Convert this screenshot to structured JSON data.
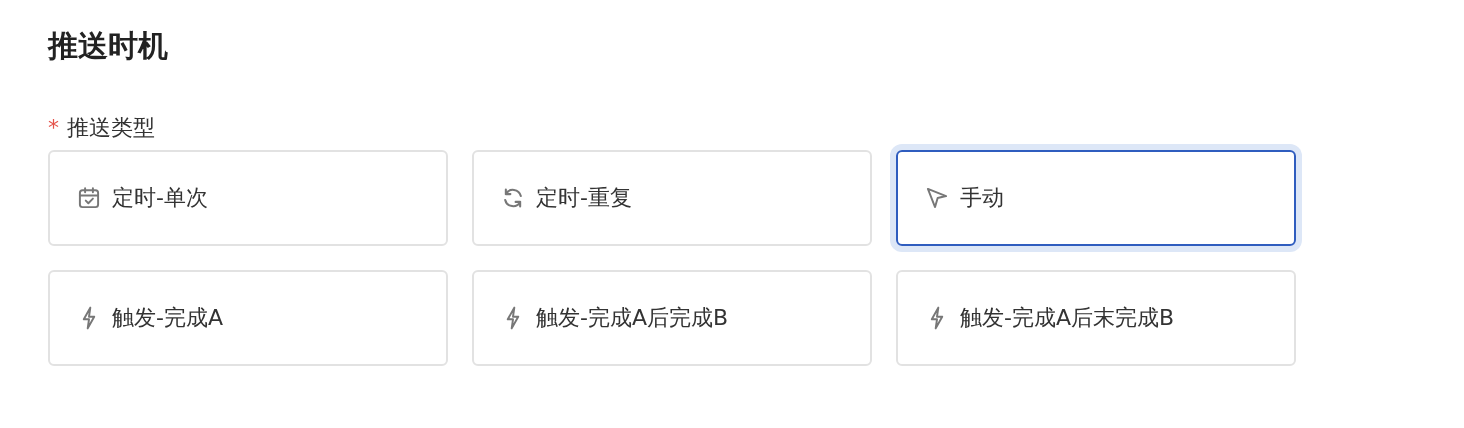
{
  "section_title": "推送时机",
  "field": {
    "required_mark": "*",
    "label": "推送类型"
  },
  "options": [
    {
      "kind": "calendar",
      "label": "定时-单次",
      "selected": false
    },
    {
      "kind": "repeat",
      "label": "定时-重复",
      "selected": false
    },
    {
      "kind": "pointer",
      "label": "手动",
      "selected": true
    },
    {
      "kind": "bolt",
      "label": "触发-完成A",
      "selected": false
    },
    {
      "kind": "bolt",
      "label": "触发-完成A后完成B",
      "selected": false
    },
    {
      "kind": "bolt",
      "label": "触发-完成A后末完成B",
      "selected": false
    }
  ]
}
